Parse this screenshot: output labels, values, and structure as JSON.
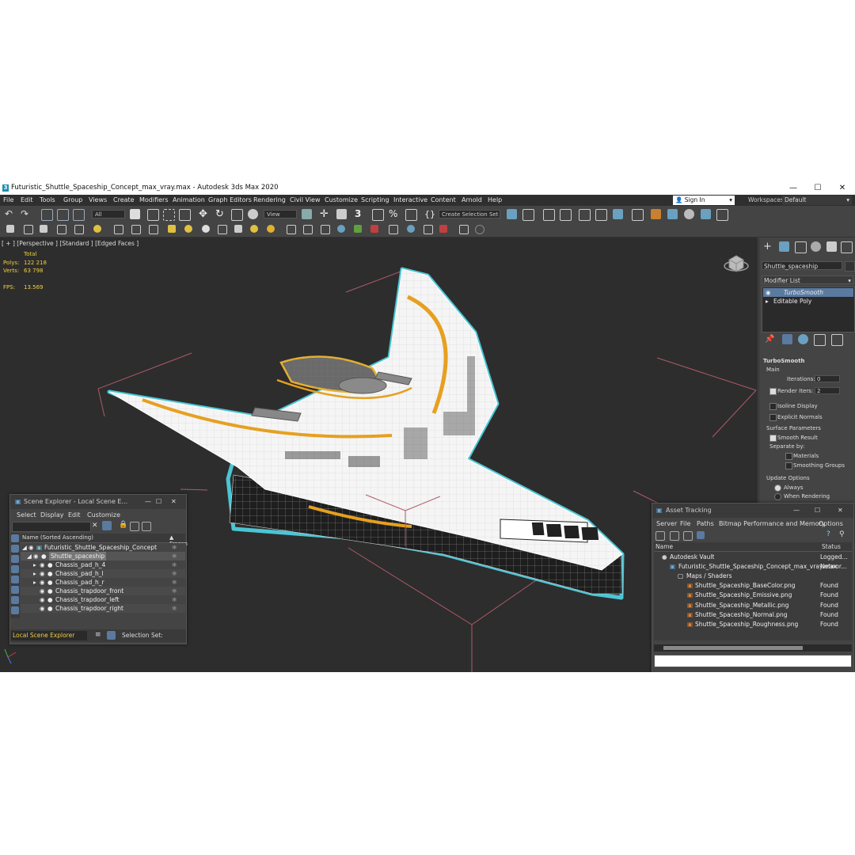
{
  "window": {
    "title": "Futuristic_Shuttle_Spaceship_Concept_max_vray.max - Autodesk 3ds Max 2020",
    "logo_letter": "3",
    "minimize": "—",
    "maximize": "☐",
    "close": "✕"
  },
  "menu": {
    "items": [
      "File",
      "Edit",
      "Tools",
      "Group",
      "Views",
      "Create",
      "Modifiers",
      "Animation",
      "Graph Editors",
      "Rendering",
      "Civil View",
      "Customize",
      "Scripting",
      "Interactive",
      "Content",
      "Arnold",
      "Help"
    ],
    "sign_in": "Sign In",
    "workspaces_label": "Workspaces:",
    "workspaces_value": "Default"
  },
  "toolbar": {
    "filter_value": "All",
    "view_value": "View",
    "selection_set_placeholder": "Create Selection Set",
    "counter": "3"
  },
  "viewport": {
    "label": "[ + ] [Perspective ] [Standard ] [Edged Faces ]",
    "stats_total": "Total",
    "polys_label": "Polys:",
    "polys_value": "122 218",
    "verts_label": "Verts:",
    "verts_value": "63 798",
    "fps_label": "FPS:",
    "fps_value": "13.569"
  },
  "scene_explorer": {
    "title": "Scene Explorer - Local Scene E...",
    "menu": [
      "Select",
      "Display",
      "Edit",
      "Customize"
    ],
    "col_name": "Name (Sorted Ascending)",
    "col_frozen": "▲ Frozen",
    "rows": [
      {
        "label": "Futuristic_Shuttle_Spaceship_Concept"
      },
      {
        "label": "Shuttle_spaceship"
      },
      {
        "label": "Chassis_pad_h_4"
      },
      {
        "label": "Chassis_pad_h_l"
      },
      {
        "label": "Chassis_pad_h_r"
      },
      {
        "label": "Chassis_trapdoor_front"
      },
      {
        "label": "Chassis_trapdoor_left"
      },
      {
        "label": "Chassis_trapdoor_right"
      }
    ],
    "footer_explorer": "Local Scene Explorer",
    "footer_selection": "Selection Set:"
  },
  "asset_tracking": {
    "title": "Asset Tracking",
    "menu": [
      "Server",
      "File",
      "Paths",
      "Bitmap Performance and Memory",
      "Options"
    ],
    "col_name": "Name",
    "col_status": "Status",
    "rows": [
      {
        "name": "Autodesk Vault",
        "status": "Logged..."
      },
      {
        "name": "Futuristic_Shuttle_Spaceship_Concept_max_vray.max",
        "status": "Networ..."
      },
      {
        "name": "Maps / Shaders",
        "status": ""
      },
      {
        "name": "Shuttle_Spaceship_BaseColor.png",
        "status": "Found"
      },
      {
        "name": "Shuttle_Spaceship_Emissive.png",
        "status": "Found"
      },
      {
        "name": "Shuttle_Spaceship_Metallic.png",
        "status": "Found"
      },
      {
        "name": "Shuttle_Spaceship_Normal.png",
        "status": "Found"
      },
      {
        "name": "Shuttle_Spaceship_Roughness.png",
        "status": "Found"
      }
    ]
  },
  "command_panel": {
    "object_name": "Shuttle_spaceship",
    "modifier_list": "Modifier List",
    "stack": [
      "TurboSmooth",
      "Editable Poly"
    ],
    "rollout_title": "TurboSmooth",
    "main_label": "Main",
    "iterations_label": "Iterations:",
    "iterations_value": "0",
    "render_iters_label": "Render Iters:",
    "render_iters_value": "2",
    "isoline": "Isoline Display",
    "explicit_normals": "Explicit Normals",
    "surface_params": "Surface Parameters",
    "smooth_result": "Smooth Result",
    "separate_by": "Separate by:",
    "materials": "Materials",
    "smoothing_groups": "Smoothing Groups",
    "update_options": "Update Options",
    "always": "Always",
    "when_rendering": "When Rendering"
  }
}
